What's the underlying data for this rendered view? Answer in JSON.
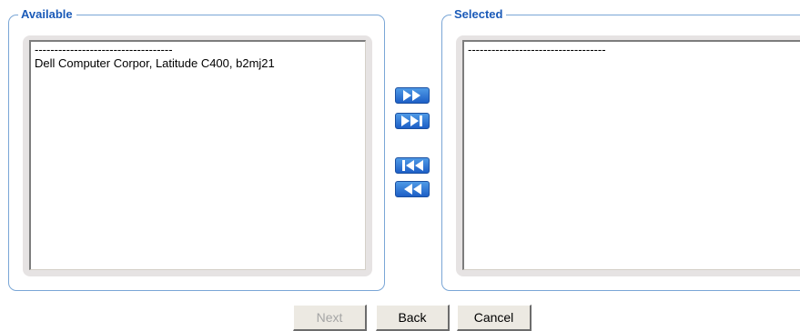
{
  "available": {
    "legend": "Available",
    "options": [
      "-----------------------------------",
      "Dell Computer Corpor, Latitude C400, b2mj21"
    ]
  },
  "selected": {
    "legend": "Selected",
    "options": [
      "-----------------------------------"
    ]
  },
  "transfer_buttons": {
    "add": "add-selected-icon",
    "add_all": "add-all-icon",
    "remove_all": "remove-all-icon",
    "remove": "remove-selected-icon"
  },
  "actions": {
    "next_label": "Next",
    "next_enabled": false,
    "back_label": "Back",
    "cancel_label": "Cancel"
  },
  "colors": {
    "legend_text": "#1a5ab8",
    "frame_border": "#7aa6d6",
    "transfer_button": "#2f78d8",
    "disabled_text": "#a5a5a5"
  }
}
